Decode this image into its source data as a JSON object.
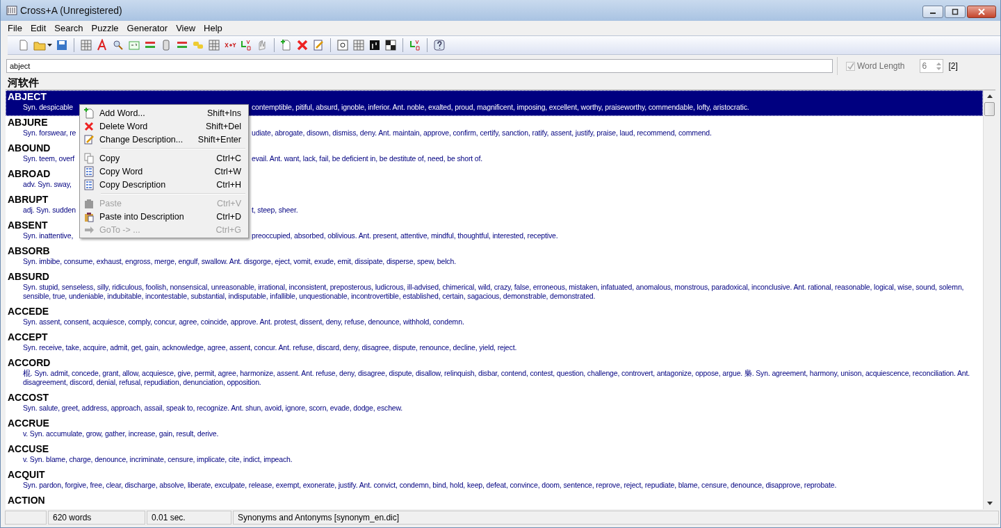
{
  "window": {
    "title": "Cross+A (Unregistered)"
  },
  "menu_bar": [
    "File",
    "Edit",
    "Search",
    "Puzzle",
    "Generator",
    "View",
    "Help"
  ],
  "search": {
    "value": "abject"
  },
  "word_length": {
    "label": "Word Length",
    "checked": true,
    "disabled": true,
    "value": "6",
    "count": "[2]"
  },
  "list_heading": "河软件",
  "entries": [
    {
      "word": "ABJECT",
      "selected": true,
      "desc": "Syn. despicable",
      "desc_after": "contemptible, pitiful, absurd, ignoble, inferior. Ant. noble, exalted, proud, magnificent, imposing, excellent, worthy, praiseworthy, commendable, lofty, aristocratic."
    },
    {
      "word": "ABJURE",
      "selected": false,
      "desc": "Syn. forswear, re",
      "desc_after": "udiate, abrogate, disown, dismiss, deny. Ant. maintain, approve, confirm, certify, sanction, ratify, assent, justify, praise, laud, recommend, commend."
    },
    {
      "word": "ABOUND",
      "selected": false,
      "desc": "Syn. teem, overf",
      "desc_after": "evail. Ant. want, lack, fail, be deficient in, be destitute of, need, be short of."
    },
    {
      "word": "ABROAD",
      "selected": false,
      "desc": "adv. Syn. sway,"
    },
    {
      "word": "ABRUPT",
      "selected": false,
      "desc": "adj. Syn. sudden",
      "desc_after": "t, steep, sheer."
    },
    {
      "word": "ABSENT",
      "selected": false,
      "desc": "Syn. inattentive,",
      "desc_after": "preoccupied, absorbed, oblivious. Ant. present, attentive, mindful, thoughtful, interested, receptive."
    },
    {
      "word": "ABSORB",
      "selected": false,
      "desc": "Syn. imbibe, consume, exhaust, engross, merge, engulf, swallow. Ant. disgorge, eject, vomit, exude, emit, dissipate, disperse, spew, belch."
    },
    {
      "word": "ABSURD",
      "selected": false,
      "desc": "Syn. stupid, senseless, silly, ridiculous, foolish, nonsensical, unreasonable, irrational, inconsistent, preposterous, ludicrous, ill-advised, chimerical, wild, crazy, false, erroneous, mistaken, infatuated, anomalous, monstrous, paradoxical, inconclusive. Ant. rational, reasonable, logical, wise, sound, solemn, sensible, true, undeniable, indubitable, incontestable, substantial, indisputable, infallible, unquestionable, incontrovertible, established, certain, sagacious, demonstrable, demonstrated."
    },
    {
      "word": "ACCEDE",
      "selected": false,
      "desc": "Syn. assent, consent, acquiesce, comply, concur, agree, coincide, approve. Ant. protest, dissent, deny, refuse, denounce, withhold, condemn."
    },
    {
      "word": "ACCEPT",
      "selected": false,
      "desc": "Syn. receive, take, acquire, admit, get, gain, acknowledge, agree, assent, concur. Ant. refuse, discard, deny, disagree, dispute, renounce, decline, yield, reject."
    },
    {
      "word": "ACCORD",
      "selected": false,
      "desc": "棍. Syn. admit, concede, grant, allow, acquiesce, give, permit, agree, harmonize, assent. Ant. refuse, deny, disagree, dispute, disallow, relinquish, disbar, contend, contest, question, challenge, controvert, antagonize, oppose, argue. 梟. Syn. agreement, harmony, unison, acquiescence, reconciliation. Ant. disagreement, discord, denial, refusal, repudiation, denunciation, opposition."
    },
    {
      "word": "ACCOST",
      "selected": false,
      "desc": "Syn. salute, greet, address, approach, assail, speak to, recognize. Ant. shun, avoid, ignore, scorn, evade, dodge, eschew."
    },
    {
      "word": "ACCRUE",
      "selected": false,
      "desc": "v. Syn. accumulate, grow, gather, increase, gain, result, derive."
    },
    {
      "word": "ACCUSE",
      "selected": false,
      "desc": "v. Syn. blame, charge, denounce, incriminate, censure, implicate, cite, indict, impeach."
    },
    {
      "word": "ACQUIT",
      "selected": false,
      "desc": "Syn. pardon, forgive, free, clear, discharge, absolve, liberate, exculpate, release, exempt, exonerate, justify. Ant. convict, condemn, bind, hold, keep, defeat, convince, doom, sentence, reprove, reject, repudiate, blame, censure, denounce, disapprove, reprobate."
    },
    {
      "word": "ACTION",
      "selected": false
    }
  ],
  "context_menu": [
    {
      "kind": "item",
      "label": "Add Word...",
      "shortcut": "Shift+Ins",
      "disabled": false
    },
    {
      "kind": "item",
      "label": "Delete Word",
      "shortcut": "Shift+Del",
      "disabled": false
    },
    {
      "kind": "item",
      "label": "Change Description...",
      "shortcut": "Shift+Enter",
      "disabled": false
    },
    {
      "kind": "separator"
    },
    {
      "kind": "item",
      "label": "Copy",
      "shortcut": "Ctrl+C",
      "disabled": false
    },
    {
      "kind": "item",
      "label": "Copy Word",
      "shortcut": "Ctrl+W",
      "disabled": false
    },
    {
      "kind": "item",
      "label": "Copy Description",
      "shortcut": "Ctrl+H",
      "disabled": false
    },
    {
      "kind": "separator"
    },
    {
      "kind": "item",
      "label": "Paste",
      "shortcut": "Ctrl+V",
      "disabled": true
    },
    {
      "kind": "item",
      "label": "Paste into Description",
      "shortcut": "Ctrl+D",
      "disabled": false
    },
    {
      "kind": "item",
      "label": "GoTo  ->  ...",
      "shortcut": "Ctrl+G",
      "disabled": true
    }
  ],
  "status_bar": [
    "620 words",
    "0.01 sec.",
    "Synonyms and Antonyms [synonym_en.dic]"
  ]
}
